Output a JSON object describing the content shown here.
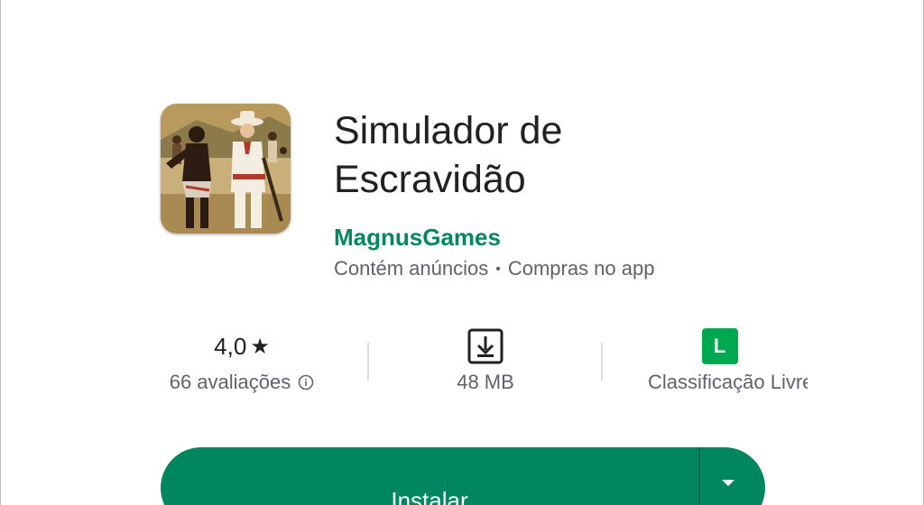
{
  "app": {
    "title": "Simulador de Escravidão",
    "developer": "MagnusGames",
    "contains_ads": "Contém anúncios",
    "in_app_purchases": "Compras no app",
    "icon": "app-icon-illustration"
  },
  "stats": {
    "rating_value": "4,0",
    "rating_star": "★",
    "reviews": "66 avaliações",
    "size": "48 MB",
    "content_rating_badge": "L",
    "content_rating_label": "Classificação Livre"
  },
  "install": {
    "label": "Instalar"
  },
  "colors": {
    "accent": "#01875f",
    "rating_badge": "#00a94f",
    "secondary_text": "#5f6368"
  }
}
